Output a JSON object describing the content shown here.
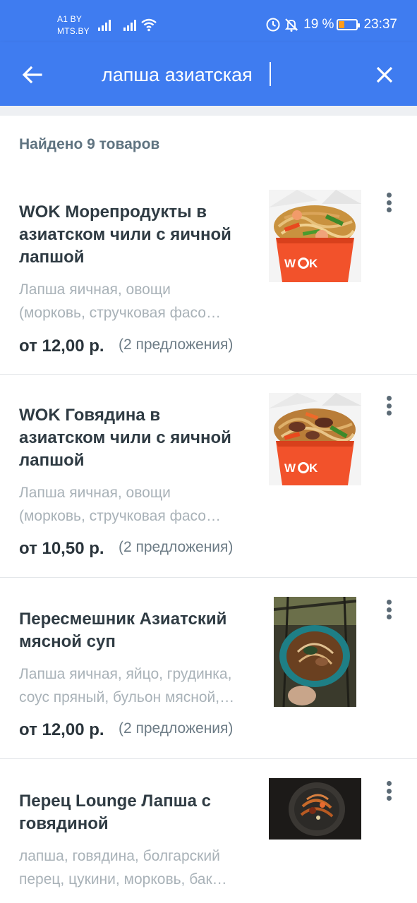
{
  "status_bar": {
    "carrier_line1": "A1 BY",
    "carrier_line2": "MTS.BY",
    "battery_percent": "19 %",
    "time": "23:37",
    "icons": [
      "signal-icon",
      "signal-icon",
      "wifi-icon",
      "data-saver-icon",
      "mute-icon",
      "battery-icon"
    ]
  },
  "search": {
    "query": "лапша азиатская",
    "back_icon": "arrow-left-icon",
    "clear_icon": "close-icon"
  },
  "results": {
    "found_text": "Найдено 9 товаров",
    "items": [
      {
        "title_lines": [
          "WOK Морепродукты в",
          "азиатском чили с яичной",
          "лапшой"
        ],
        "desc_lines": [
          "Лапша яичная, овощи",
          "(морковь, стручковая фасо…"
        ],
        "price": "от 12,00 р.",
        "offers": "(2 предложения)",
        "image": "wok-seafood-noodle-box"
      },
      {
        "title_lines": [
          "WOK Говядина в",
          "азиатском чили с яичной",
          "лапшой"
        ],
        "desc_lines": [
          "Лапша яичная, овощи",
          "(морковь, стручковая фасо…"
        ],
        "price": "от 10,50 р.",
        "offers": "(2 предложения)",
        "image": "wok-beef-noodle-box"
      },
      {
        "title_lines": [
          "Пересмешник Азиатский",
          "мясной суп"
        ],
        "desc_lines": [
          "Лапша яичная, яйцо, грудинка,",
          "соус пряный, бульон мясной,…"
        ],
        "price": "от 12,00 р.",
        "offers": "(2 предложения)",
        "image": "soup-bowl-photo"
      },
      {
        "title_lines": [
          "Перец Lounge Лапша с",
          "говядиной"
        ],
        "desc_lines": [
          "лапша, говядина, болгарский",
          "перец, цукини, морковь, бак…"
        ],
        "price": "",
        "offers": "",
        "image": "beef-noodle-plate-photo"
      }
    ]
  },
  "colors": {
    "primary": "#3f7cf0",
    "title_text": "#2f3b43",
    "desc_text": "#a9b2b8",
    "wok_orange": "#f2522b"
  }
}
